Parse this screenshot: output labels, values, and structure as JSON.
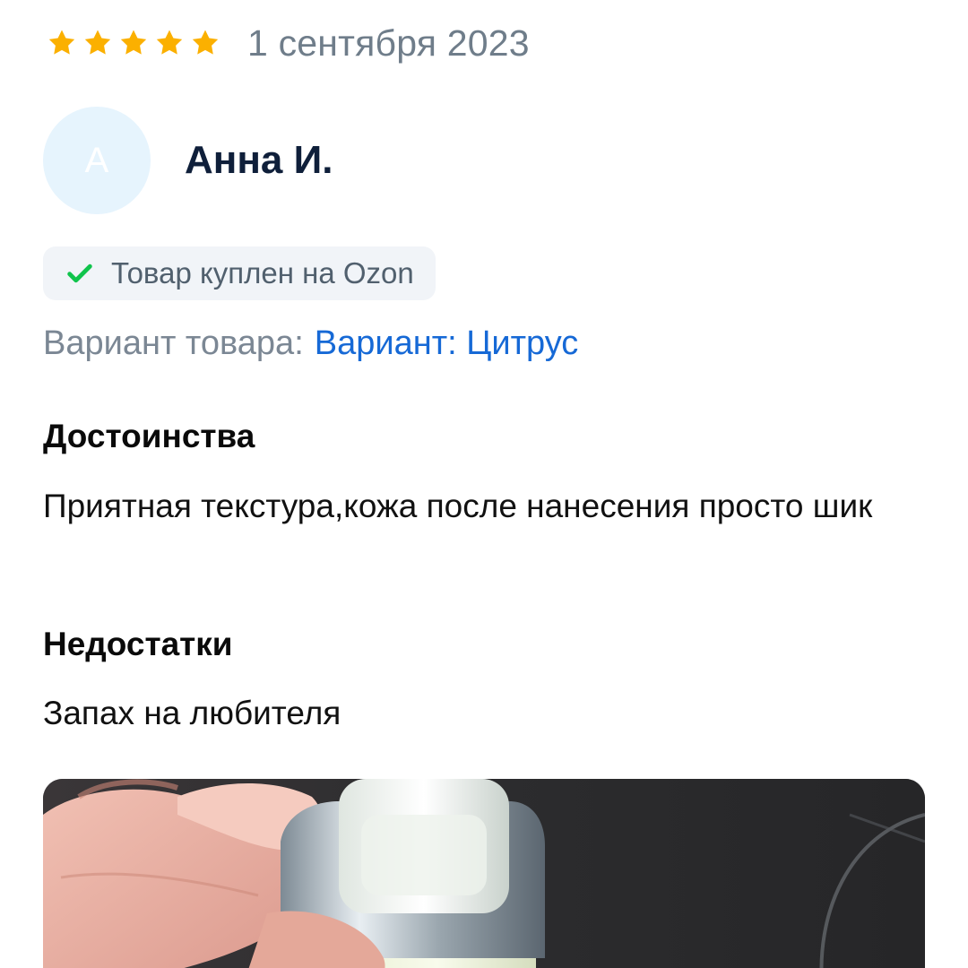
{
  "review": {
    "rating": 5,
    "rating_max": 5,
    "date": "1 сентября 2023",
    "star_color": "#fbb000",
    "author": {
      "avatar_letter": "А",
      "name": "Анна И."
    },
    "badge": {
      "icon": "check-icon",
      "text": "Товар куплен на Ozon"
    },
    "variant": {
      "label": "Вариант товара:",
      "value": "Вариант: Цитрус"
    },
    "pros": {
      "title": "Достоинства",
      "text": "Приятная текстура,кожа после нанесения просто шик"
    },
    "cons": {
      "title": "Недостатки",
      "text": "Запах на любителя"
    }
  },
  "colors": {
    "link": "#1669d6",
    "check": "#10c44c",
    "muted": "#6f7d8a"
  }
}
